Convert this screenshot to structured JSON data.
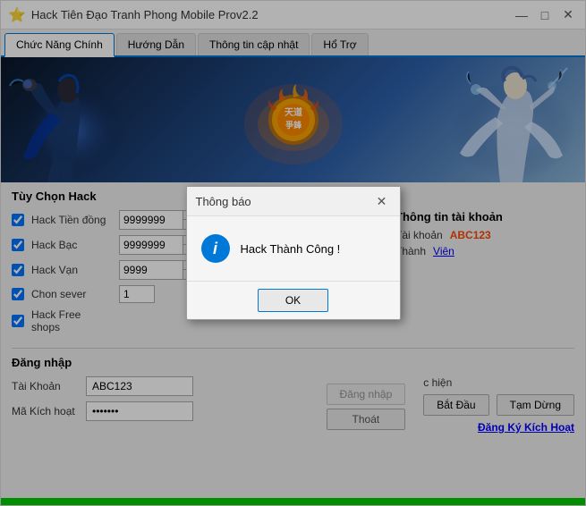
{
  "window": {
    "title": "Hack Tiên Đạo Tranh Phong Mobile  Prov2.2",
    "icon": "⭐"
  },
  "titlebar": {
    "minimize": "—",
    "maximize": "□",
    "close": "✕"
  },
  "tabs": [
    {
      "label": "Chức Năng Chính",
      "active": true
    },
    {
      "label": "Hướng Dẫn",
      "active": false
    },
    {
      "label": "Thông tin cập nhật",
      "active": false
    },
    {
      "label": "Hổ Trợ",
      "active": false
    }
  ],
  "hack_section": {
    "title": "Tùy Chọn Hack",
    "options": [
      {
        "label": "Hack Tiền đồng",
        "checked": true,
        "value": "9999999"
      },
      {
        "label": "Hack Bạc",
        "checked": true,
        "value": "9999999"
      },
      {
        "label": "Hack Vạn",
        "checked": true,
        "value": "9999"
      },
      {
        "label": "Chon sever",
        "checked": true,
        "value": "1"
      },
      {
        "label": "Hack Free shops",
        "checked": true,
        "value": ""
      }
    ]
  },
  "account_info": {
    "title": "Thông tin tài khoản",
    "account_label": "Tài khoản",
    "account_value": "ABC123",
    "member_label": "Thành",
    "member_value": "Viên"
  },
  "login_section": {
    "title": "Đăng nhập",
    "account_label": "Tài Khoản",
    "account_value": "ABC123",
    "password_label": "Mã Kích hoạt",
    "password_value": "•••••••",
    "btn_login": "Đăng nhập",
    "btn_exit": "Thoát"
  },
  "action_section": {
    "hien_label": "c hiện",
    "btn_start": "Bắt Đầu",
    "btn_pause": "Tạm Dừng",
    "btn_register": "Đăng Ký Kích Hoạt"
  },
  "modal": {
    "title": "Thông báo",
    "message": "Hack Thành Công !",
    "btn_ok": "OK",
    "icon": "i"
  },
  "status_bar": {
    "color": "#00cc00"
  }
}
